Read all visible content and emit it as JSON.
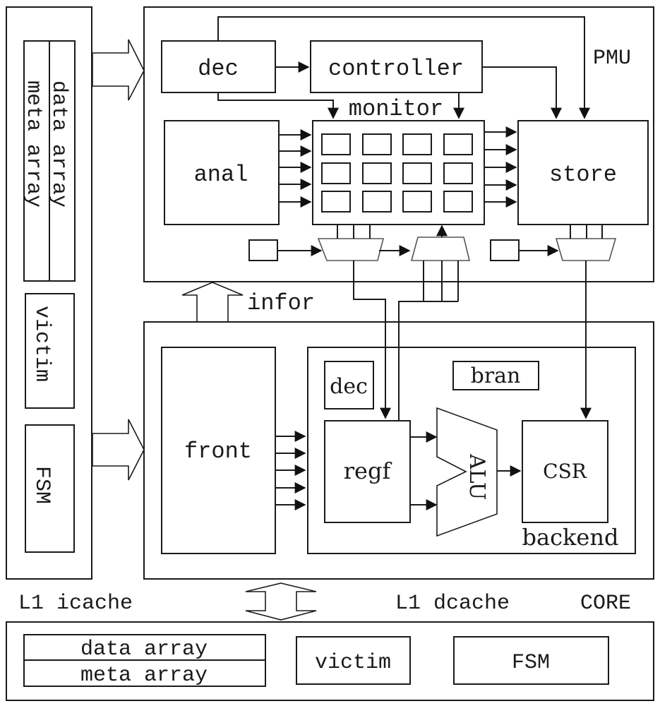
{
  "diagram": {
    "pmu": {
      "title": "PMU",
      "dec": "dec",
      "controller": "controller",
      "monitor": "monitor",
      "anal": "anal",
      "store": "store"
    },
    "infor_label": "infor",
    "core": {
      "title": "CORE",
      "front": "front",
      "backend": {
        "title": "backend",
        "dec": "dec",
        "bran": "bran",
        "regf": "regf",
        "alu": "ALU",
        "csr": "CSR"
      }
    },
    "l1_icache": {
      "title": "L1 icache",
      "data_array": "data array",
      "meta_array": "meta array",
      "victim": "victim",
      "fsm": "FSM"
    },
    "l1_dcache": {
      "title": "L1 dcache",
      "data_array": "data array",
      "meta_array": "meta array",
      "victim": "victim",
      "fsm": "FSM"
    }
  }
}
